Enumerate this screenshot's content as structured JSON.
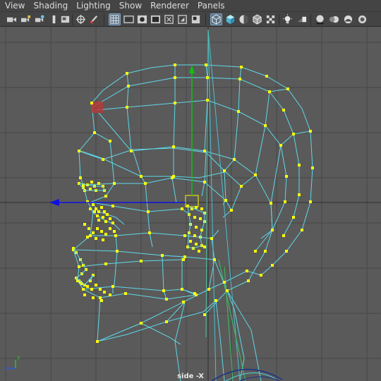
{
  "menu": [
    "View",
    "Shading",
    "Lighting",
    "Show",
    "Renderer",
    "Panels"
  ],
  "toolbar": {
    "icons": [
      "camera-select-icon",
      "camera-attributes-icon",
      "bookmark-icon",
      "image-plane-icon",
      "two-d-pan-icon",
      "grease-pencil-icon",
      "grid-icon",
      "film-gate-icon",
      "resolution-gate-icon",
      "gate-mask-icon",
      "field-chart-icon",
      "safe-action-icon",
      "wireframe-icon",
      "smooth-shade-icon",
      "use-default-material-icon",
      "wireframe-on-shaded-icon",
      "xray-icon",
      "use-all-lights-icon",
      "shadows-icon",
      "screen-space-ambient-occlusion-icon",
      "motion-blur-icon",
      "multisample-antialiasing-icon"
    ],
    "active": [
      "grid-icon",
      "wireframe-icon"
    ]
  },
  "viewport": {
    "label": "side -X",
    "colors": {
      "background": "#5a5a5a",
      "grid": "#474747",
      "grid_axis": "#2e2e2e",
      "wireframe": "#5fd8e8",
      "vertex": "#ffff00",
      "selected_face": "#b43a3a",
      "x_axis_arrow": "#1010e0",
      "y_axis_arrow": "#10c010"
    },
    "axis_labels": {
      "y": "y",
      "z": "z"
    }
  }
}
